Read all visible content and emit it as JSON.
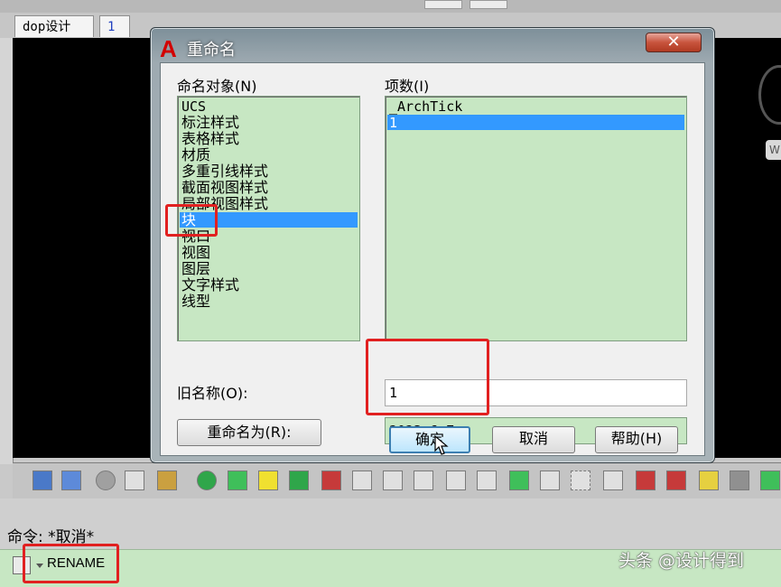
{
  "tabs": [
    {
      "label": "dop设计"
    },
    {
      "label": "1"
    }
  ],
  "dialog": {
    "logo": "A",
    "title": "重命名",
    "close_glyph": "✕",
    "objects_label": "命名对象",
    "objects_shortcut": "(N)",
    "items_label": "项数",
    "items_shortcut": "(I)",
    "object_list": [
      "UCS",
      "标注样式",
      "表格样式",
      "材质",
      "多重引线样式",
      "截面视图样式",
      "局部视图样式",
      "块",
      "视口",
      "视图",
      "图层",
      "文字样式",
      "线型"
    ],
    "selected_object": "块",
    "item_list": [
      "_ArchTick",
      "1"
    ],
    "selected_item": "1",
    "old_name_label": "旧名称(O):",
    "old_name_value": "1",
    "rename_to_button": "重命名为(R):",
    "rename_to_value": "2023.6.7",
    "ok_button": "确定",
    "cancel_button": "取消",
    "help_button": "帮助(H)"
  },
  "command": {
    "history": "命令: *取消*",
    "input": "RENAME"
  },
  "watermark": "头条 @设计得到",
  "right_widget_label": "W",
  "colors": {
    "accent": "#3399ff",
    "list_bg": "#c7e7c3",
    "annotation_red": "#e12020"
  }
}
